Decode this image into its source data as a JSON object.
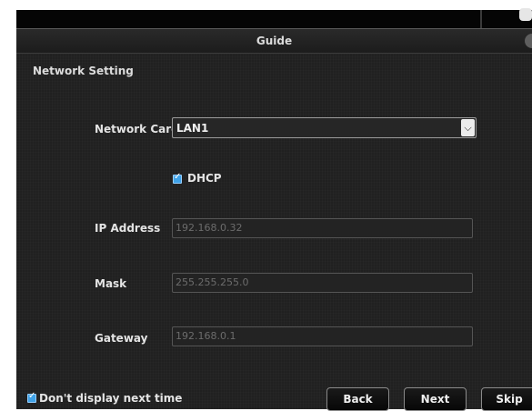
{
  "dialog": {
    "title": "Guide",
    "section": "Network Setting"
  },
  "network_card": {
    "label": "Network Card",
    "value": "LAN1"
  },
  "dhcp": {
    "label": "DHCP",
    "checked": true
  },
  "ip_address": {
    "label": "IP Address",
    "value": "192.168.0.32"
  },
  "mask": {
    "label": "Mask",
    "value": "255.255.255.0"
  },
  "gateway": {
    "label": "Gateway",
    "value": "192.168.0.1"
  },
  "footer": {
    "dont_display_label": "Don't display next time",
    "dont_display_checked": true,
    "back_label": "Back",
    "next_label": "Next",
    "skip_label": "Skip"
  },
  "icons": {
    "dropdown": "chevron-down-icon",
    "checkbox": "checkmark-icon"
  },
  "colors": {
    "checkbox_accent": "#3fa2e8",
    "panel_background": "#202020"
  }
}
